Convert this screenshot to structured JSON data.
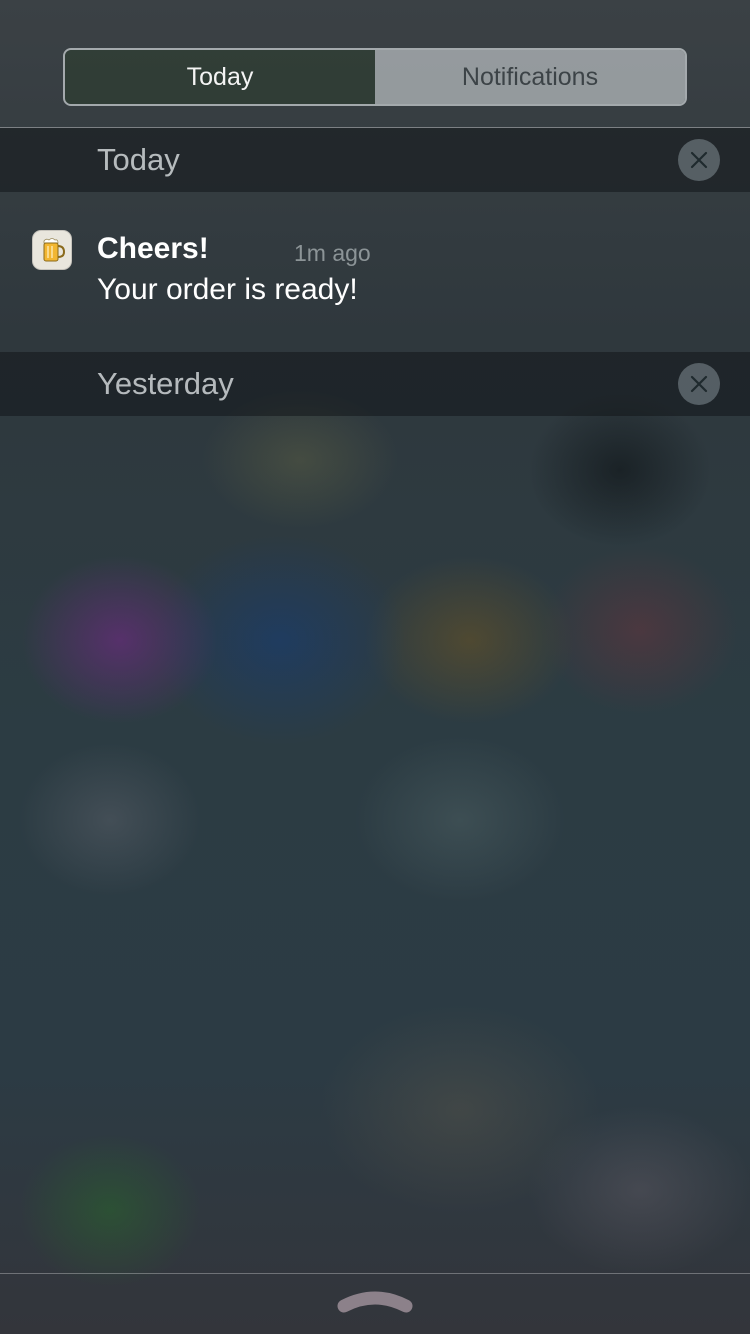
{
  "tabs": [
    {
      "label": "Today",
      "active": true
    },
    {
      "label": "Notifications",
      "active": false
    }
  ],
  "sections": [
    {
      "title": "Today",
      "clear_icon": "close-icon"
    },
    {
      "title": "Yesterday",
      "clear_icon": "close-icon"
    }
  ],
  "notification": {
    "app_icon": "beer-mug-icon",
    "title": "Cheers!",
    "time": "1m ago",
    "body": "Your order is ready!"
  },
  "handle_icon": "chevron-up-icon"
}
